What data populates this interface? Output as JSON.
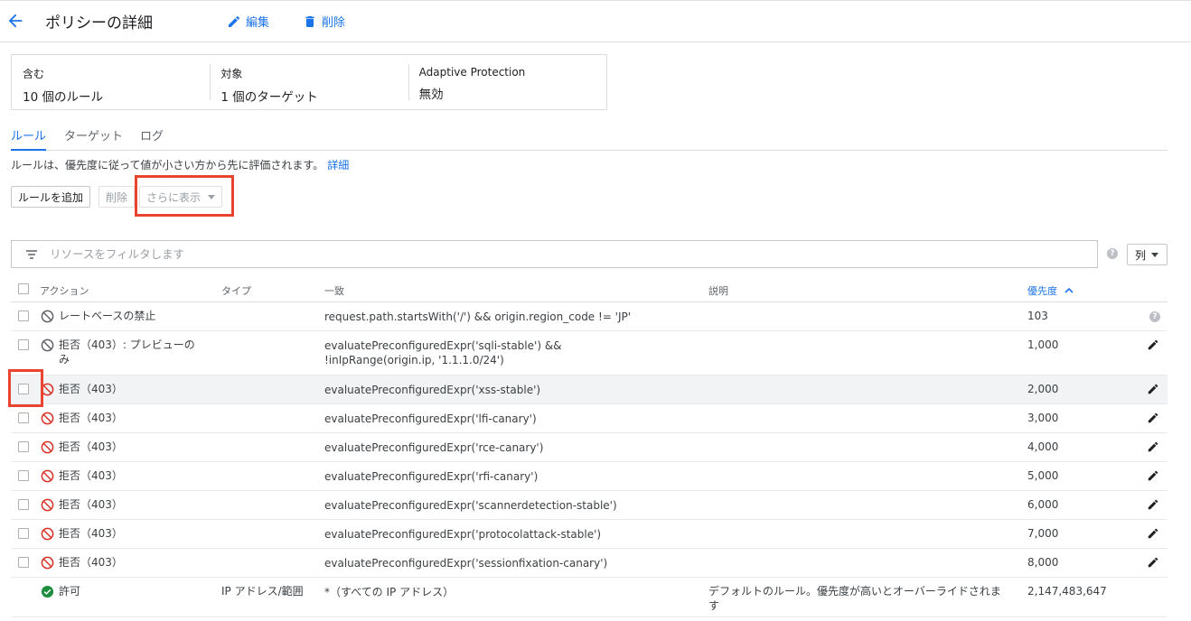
{
  "header": {
    "title": "ポリシーの詳細",
    "edit_label": "編集",
    "delete_label": "削除"
  },
  "summary": {
    "includes_label": "含む",
    "includes_value": "10 個のルール",
    "targets_label": "対象",
    "targets_value": "1 個のターゲット",
    "adaptive_label": "Adaptive Protection",
    "adaptive_value": "無効"
  },
  "tabs": [
    {
      "label": "ルール",
      "active": true
    },
    {
      "label": "ターゲット",
      "active": false
    },
    {
      "label": "ログ",
      "active": false
    }
  ],
  "description": {
    "text": "ルールは、優先度に従って値が小さい方から先に評価されます。",
    "link": "詳細"
  },
  "toolbar": {
    "add_rule": "ルールを追加",
    "delete": "削除",
    "show_more": "さらに表示"
  },
  "filter": {
    "placeholder": "リソースをフィルタします",
    "columns_label": "列"
  },
  "table": {
    "headers": {
      "action": "アクション",
      "type": "タイプ",
      "match": "一致",
      "description": "説明",
      "priority": "優先度"
    },
    "rows": [
      {
        "action": "レートベースの禁止",
        "icon": "block-grey-icon",
        "type": "",
        "match": "request.path.startsWith('/') && origin.region_code != 'JP'",
        "description": "",
        "priority": "103",
        "editable": false
      },
      {
        "action": "拒否（403）: プレビューのみ",
        "icon": "block-grey-icon",
        "type": "",
        "match": "evaluatePreconfiguredExpr('sqli-stable') && !inIpRange(origin.ip, '1.1.1.0/24')",
        "description": "",
        "priority": "1,000",
        "editable": true
      },
      {
        "action": "拒否（403）",
        "icon": "block-red-icon",
        "type": "",
        "match": "evaluatePreconfiguredExpr('xss-stable')",
        "description": "",
        "priority": "2,000",
        "editable": true
      },
      {
        "action": "拒否（403）",
        "icon": "block-red-icon",
        "type": "",
        "match": "evaluatePreconfiguredExpr('lfi-canary')",
        "description": "",
        "priority": "3,000",
        "editable": true
      },
      {
        "action": "拒否（403）",
        "icon": "block-red-icon",
        "type": "",
        "match": "evaluatePreconfiguredExpr('rce-canary')",
        "description": "",
        "priority": "4,000",
        "editable": true
      },
      {
        "action": "拒否（403）",
        "icon": "block-red-icon",
        "type": "",
        "match": "evaluatePreconfiguredExpr('rfi-canary')",
        "description": "",
        "priority": "5,000",
        "editable": true
      },
      {
        "action": "拒否（403）",
        "icon": "block-red-icon",
        "type": "",
        "match": "evaluatePreconfiguredExpr('scannerdetection-stable')",
        "description": "",
        "priority": "6,000",
        "editable": true
      },
      {
        "action": "拒否（403）",
        "icon": "block-red-icon",
        "type": "",
        "match": "evaluatePreconfiguredExpr('protocolattack-stable')",
        "description": "",
        "priority": "7,000",
        "editable": true
      },
      {
        "action": "拒否（403）",
        "icon": "block-red-icon",
        "type": "",
        "match": "evaluatePreconfiguredExpr('sessionfixation-canary')",
        "description": "",
        "priority": "8,000",
        "editable": true
      },
      {
        "action": "許可",
        "icon": "check-green-icon",
        "type": "IP アドレス/範囲",
        "match": "*（すべての IP アドレス）",
        "description": "デフォルトのルール。優先度が高いとオーバーライドされます",
        "priority": "2,147,483,647",
        "editable": false
      }
    ]
  },
  "colors": {
    "accent": "#1a73e8",
    "highlight_box": "#e8442f",
    "deny_red": "#d93025",
    "allow_green": "#1e8e3e"
  }
}
